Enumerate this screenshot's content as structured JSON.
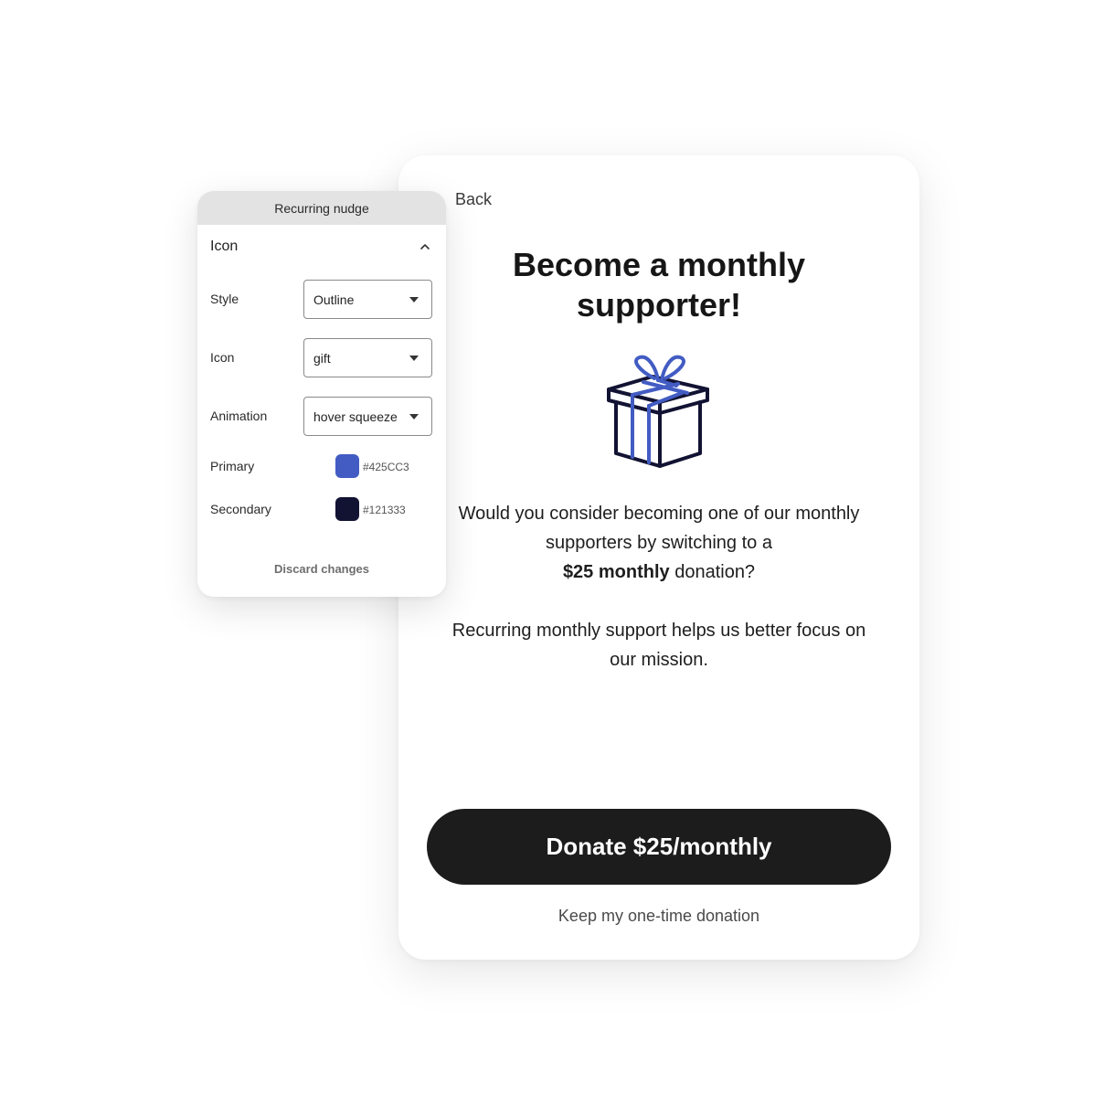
{
  "card": {
    "back_label": "Back",
    "title_line1": "Become a monthly",
    "title_line2": "supporter!",
    "icon": "gift-icon",
    "question_line1": "Would you consider becoming one of our monthly",
    "question_line2": "supporters by switching to a",
    "question_bold": "$25 monthly",
    "question_rest": " donation?",
    "mission_line1": "Recurring monthly support helps us better focus on",
    "mission_line2": "our mission.",
    "donate_label": "Donate $25/monthly",
    "keep_label": "Keep my one-time donation"
  },
  "panel": {
    "header": "Recurring nudge",
    "section_title": "Icon",
    "section_icon": "chevron-up-icon",
    "style_label": "Style",
    "style_value": "Outline",
    "icon_label": "Icon",
    "icon_value": "gift",
    "animation_label": "Animation",
    "animation_value": "hover squeeze",
    "primary_label": "Primary",
    "primary_hex": "#425CC3",
    "secondary_label": "Secondary",
    "secondary_hex": "#121333",
    "discard_label": "Discard changes"
  },
  "colors": {
    "primary": "#425CC3",
    "secondary": "#121333",
    "button": "#1C1C1C"
  }
}
